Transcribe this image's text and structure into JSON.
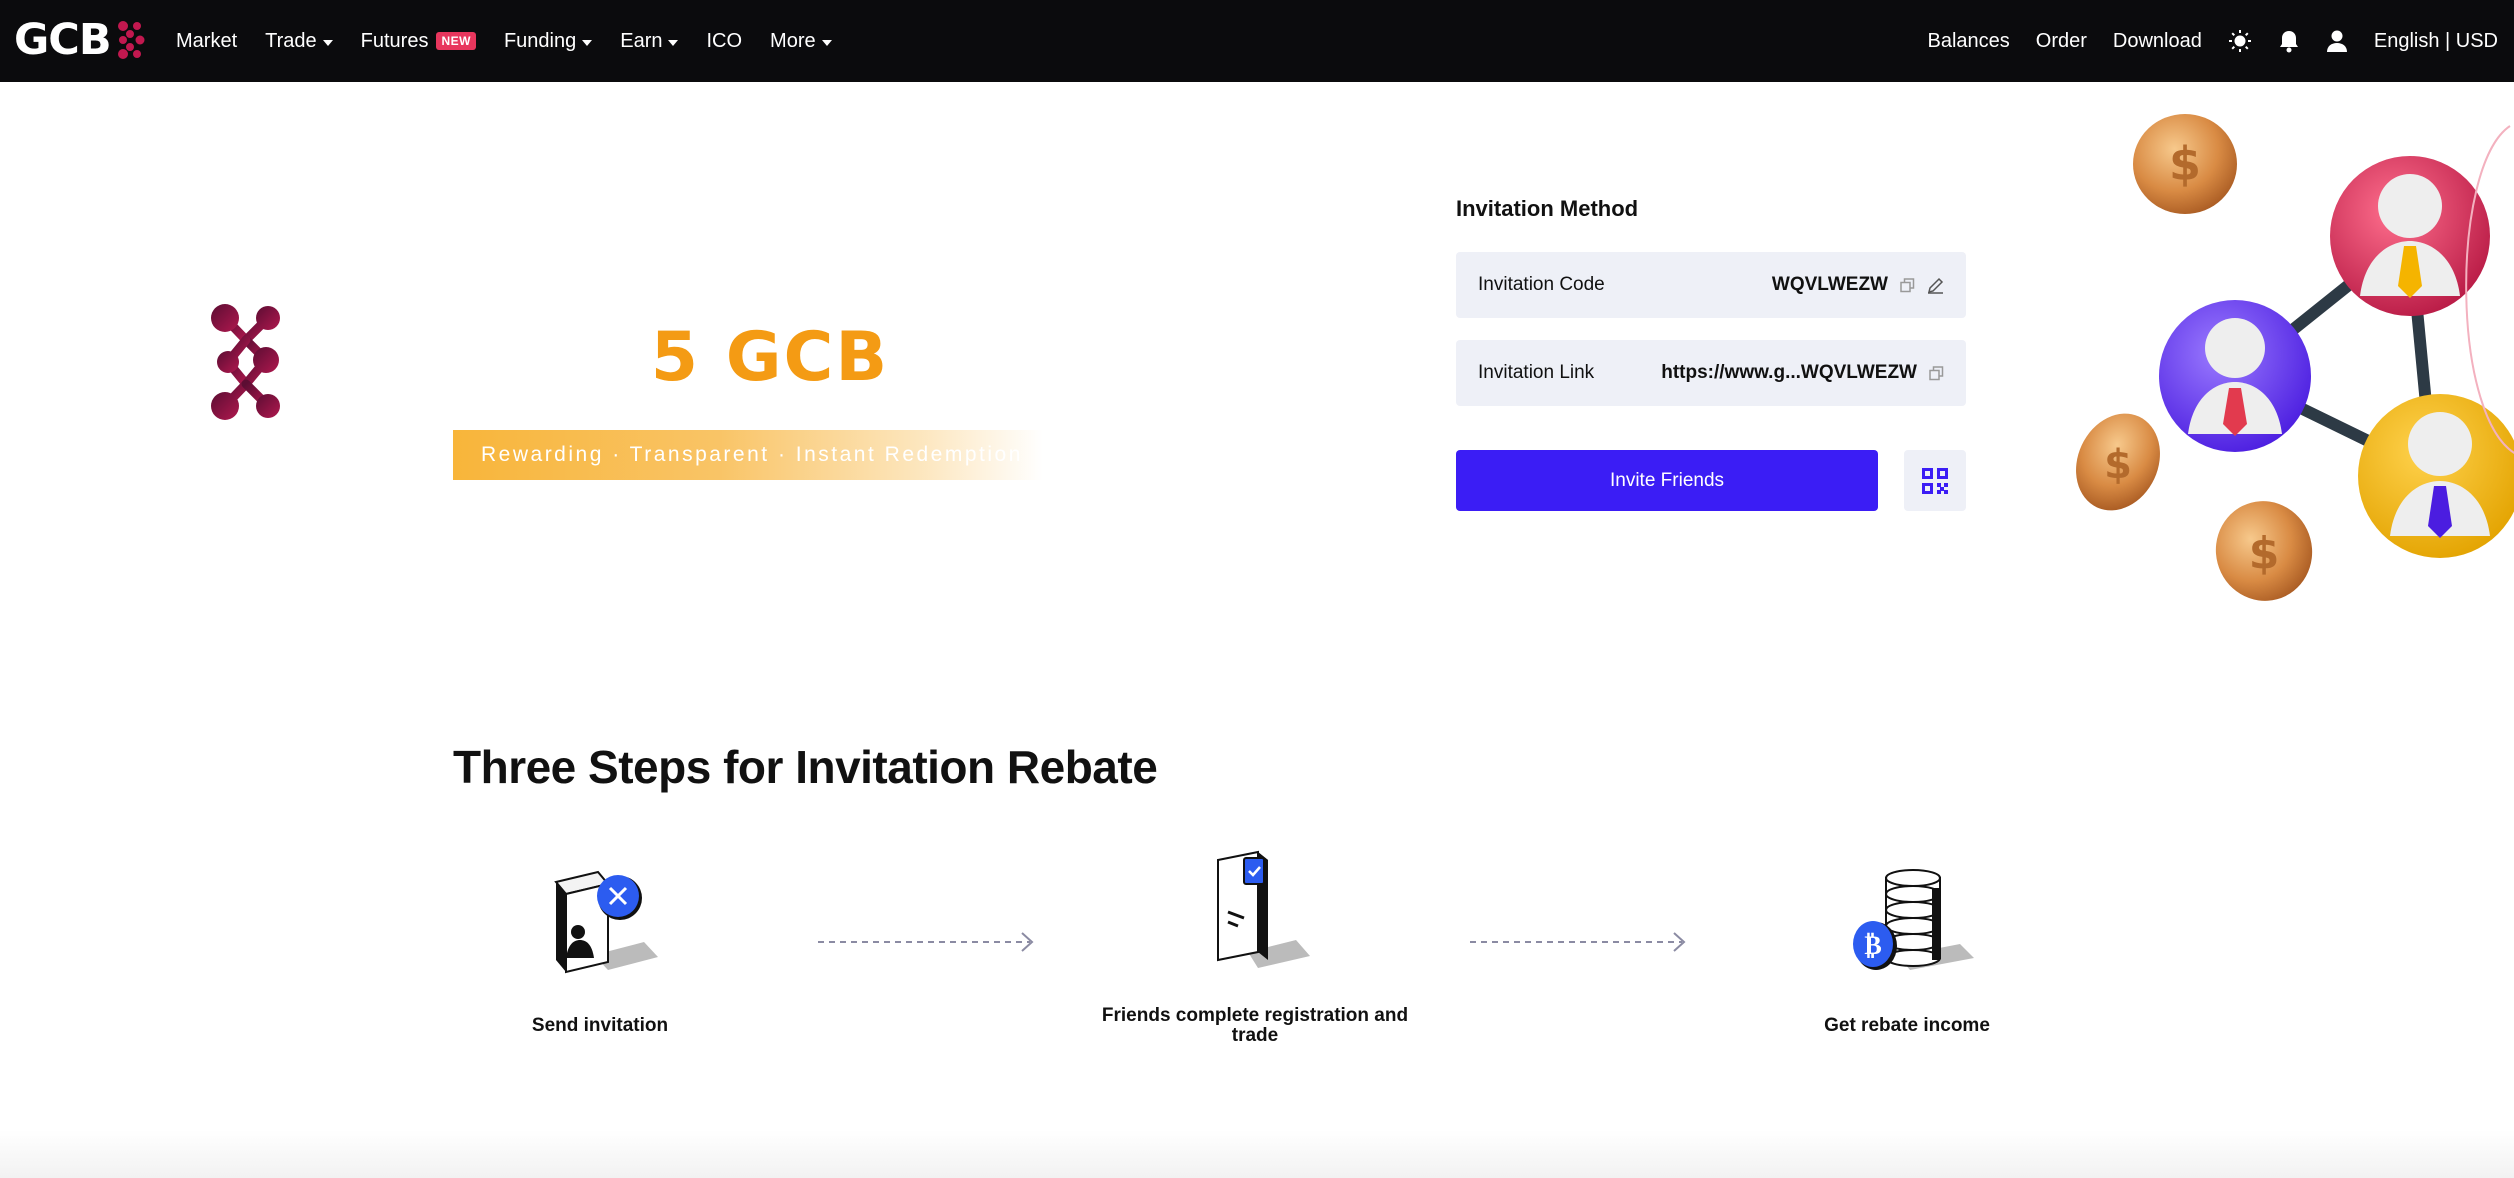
{
  "header": {
    "logo_text": "GCB",
    "nav": [
      {
        "label": "Market",
        "dropdown": false
      },
      {
        "label": "Trade",
        "dropdown": true
      },
      {
        "label": "Futures",
        "dropdown": false,
        "badge": "NEW"
      },
      {
        "label": "Funding",
        "dropdown": true
      },
      {
        "label": "Earn",
        "dropdown": true
      },
      {
        "label": "ICO",
        "dropdown": false
      },
      {
        "label": "More",
        "dropdown": true
      }
    ],
    "right": {
      "balances": "Balances",
      "order": "Order",
      "download": "Download",
      "icons": [
        "sun-icon",
        "bell-icon",
        "user-icon"
      ],
      "language": "English | USD"
    }
  },
  "hero": {
    "amount": "5 GCB",
    "banner": "Rewarding · Transparent · Instant Redemption",
    "colors": {
      "amount": "#f49b14",
      "brand": "#8a1242"
    }
  },
  "invitation": {
    "title": "Invitation Method",
    "code_label": "Invitation Code",
    "code_value": "WQVLWEZW",
    "link_label": "Invitation Link",
    "link_value": "https://www.g...WQVLWEZW",
    "invite_button": "Invite Friends",
    "icons": [
      "copy-icon",
      "edit-icon",
      "qr-code-icon"
    ],
    "accent": "#3b1df5"
  },
  "steps": {
    "title": "Three Steps for Invitation Rebate",
    "items": [
      {
        "label": "Send invitation",
        "icon": "invitation-card-icon"
      },
      {
        "label": "Friends complete registration and trade",
        "icon": "registration-phone-icon"
      },
      {
        "label": "Get rebate income",
        "icon": "coin-stack-icon"
      }
    ]
  }
}
